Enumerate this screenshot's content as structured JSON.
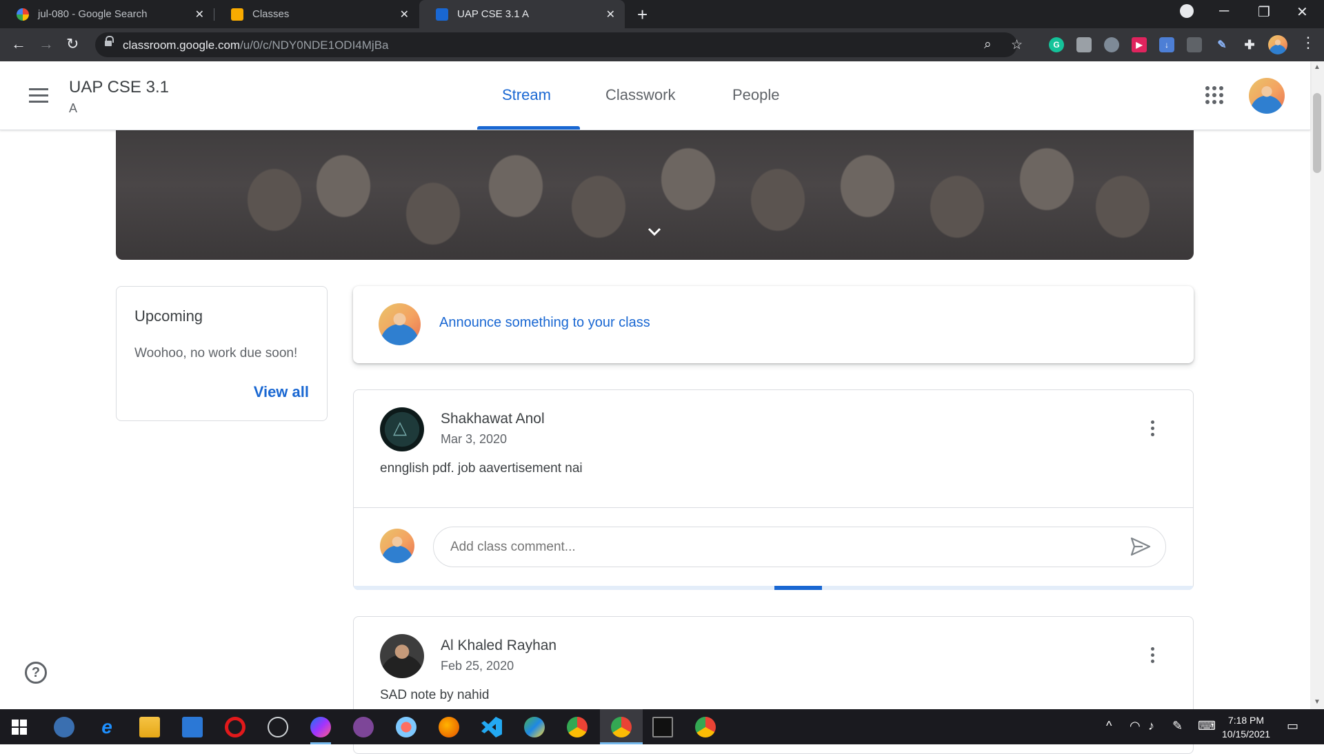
{
  "browser": {
    "tabs": [
      {
        "title": "jul-080 - Google Search",
        "icon": "google-g-icon",
        "active": false
      },
      {
        "title": "Classes",
        "icon": "classroom-icon",
        "active": false
      },
      {
        "title": "UAP CSE 3.1 A",
        "icon": "classroom-class-icon",
        "active": true
      }
    ],
    "url_domain": "classroom.google.com",
    "url_path": "/u/0/c/NDY0NDE1ODI4MjBa"
  },
  "header": {
    "class_name": "UAP CSE 3.1",
    "section": "A",
    "tabs": [
      "Stream",
      "Classwork",
      "People"
    ],
    "active_tab": "Stream"
  },
  "upcoming": {
    "title": "Upcoming",
    "message": "Woohoo, no work due soon!",
    "view_all": "View all"
  },
  "announce": {
    "prompt": "Announce something to your class"
  },
  "posts": [
    {
      "author": "Shakhawat Anol",
      "date": "Mar 3, 2020",
      "body": "ennglish pdf. job aavertisement nai",
      "comment_placeholder": "Add class comment..."
    },
    {
      "author": "Al Khaled Rayhan",
      "date": "Feb 25, 2020",
      "body": "SAD note by nahid"
    }
  ],
  "taskbar": {
    "time": "7:18 PM",
    "date": "10/15/2021"
  },
  "colors": {
    "accent": "#1967d2",
    "chrome_dark": "#202124",
    "chrome_toolbar": "#35363a"
  }
}
